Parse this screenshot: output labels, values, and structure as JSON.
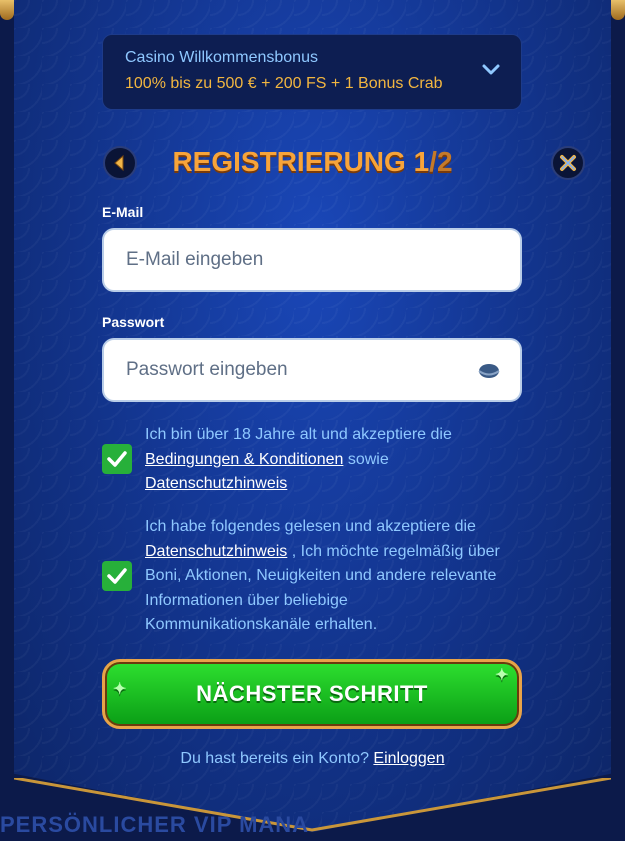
{
  "bonus": {
    "title": "Casino Willkommensbonus",
    "offer": "100% bis zu 500 € + 200 FS + 1 Bonus Crab"
  },
  "header": {
    "title": "REGISTRIERUNG",
    "step_current": "1",
    "step_total": "/2"
  },
  "form": {
    "email_label": "E-Mail",
    "email_placeholder": "E-Mail eingeben",
    "password_label": "Passwort",
    "password_placeholder": "Passwort eingeben"
  },
  "consent1": {
    "text_a": "Ich bin über 18 Jahre alt und akzeptiere die ",
    "link_terms": "Bedingungen & Konditionen",
    "text_b": " sowie ",
    "link_privacy": "Datenschutzhinweis",
    "checked": true
  },
  "consent2": {
    "text_a": "Ich habe folgendes gelesen und akzeptiere die ",
    "link_privacy": "Datenschutzhinweis",
    "text_b": " , Ich möchte regelmäßig über Boni, Aktionen, Neuigkeiten und andere relevante Informationen über beliebige Kommunikationskanäle erhalten.",
    "checked": true
  },
  "cta": {
    "label": "NÄCHSTER SCHRITT"
  },
  "login": {
    "prompt": "Du hast bereits ein Konto? ",
    "link": "Einloggen"
  },
  "footer": {
    "partial_text": "PERSÖNLICHER VIP MANA"
  },
  "colors": {
    "accent_gold": "#f7a43a",
    "link_blue": "#8fc8ff",
    "cta_green": "#1fc222"
  }
}
